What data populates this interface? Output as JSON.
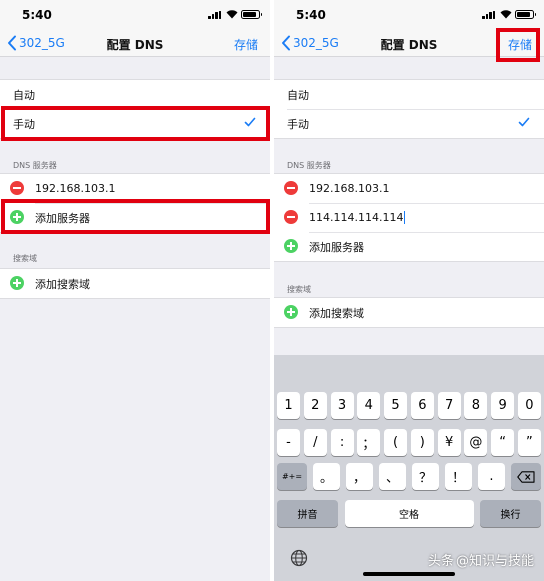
{
  "status": {
    "time": "5:40"
  },
  "nav": {
    "back_label": "302_5G",
    "title": "配置 DNS",
    "save_label": "存储"
  },
  "config_mode": {
    "options": [
      "自动",
      "手动"
    ],
    "selected": "手动"
  },
  "dns_section": {
    "header": "DNS 服务器",
    "add_label": "添加服务器"
  },
  "left_servers": [
    "192.168.103.1"
  ],
  "right_servers": [
    "192.168.103.1",
    "114.114.114.114"
  ],
  "search_section": {
    "header": "搜索域",
    "add_label": "添加搜索域"
  },
  "keyboard": {
    "row1": [
      "1",
      "2",
      "3",
      "4",
      "5",
      "6",
      "7",
      "8",
      "9",
      "0"
    ],
    "row2": [
      "-",
      "/",
      ":",
      "；",
      "(",
      ")",
      "¥",
      "@",
      "“",
      "”"
    ],
    "row3_shift": "#+=",
    "row3": [
      "。",
      "，",
      "、",
      "？",
      "！",
      "."
    ],
    "pinyin": "拼音",
    "space": "空格",
    "return": "换行"
  },
  "watermark": {
    "prefix": "头条",
    "handle": "@知识与技能"
  },
  "colors": {
    "accent": "#1a7cf5",
    "delete": "#ee3b3a",
    "add": "#4cd263",
    "highlight": "#e1000f"
  }
}
